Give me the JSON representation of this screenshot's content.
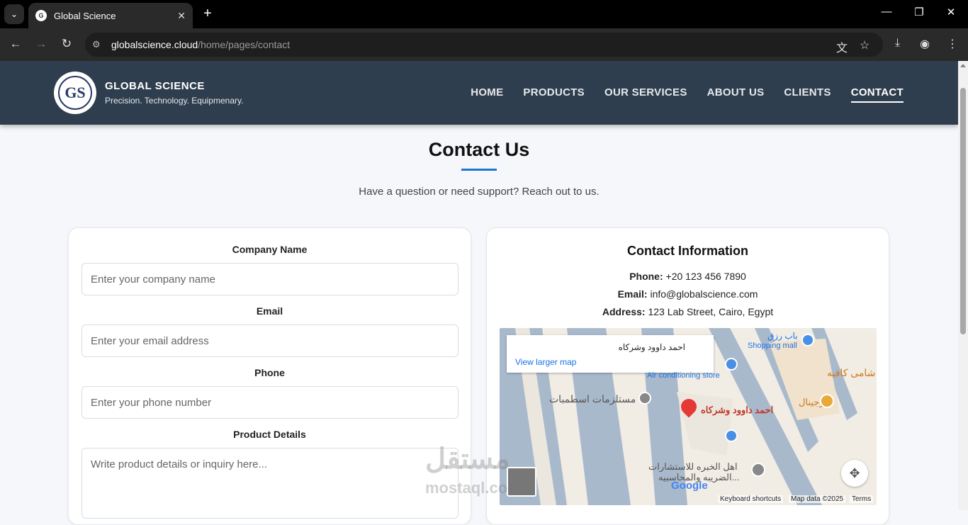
{
  "browser": {
    "tab_title": "Global Science",
    "url_domain": "globalscience.cloud",
    "url_path": "/home/pages/contact"
  },
  "header": {
    "brand_name": "GLOBAL SCIENCE",
    "tagline": "Precision. Technology. Equipmenary.",
    "logo_text": "GS",
    "nav": [
      "HOME",
      "PRODUCTS",
      "OUR SERVICES",
      "ABOUT US",
      "CLIENTS",
      "CONTACT"
    ],
    "active_nav": "CONTACT"
  },
  "page": {
    "title": "Contact Us",
    "subtitle": "Have a question or need support? Reach out to us."
  },
  "form": {
    "company_label": "Company Name",
    "company_placeholder": "Enter your company name",
    "email_label": "Email",
    "email_placeholder": "Enter your email address",
    "phone_label": "Phone",
    "phone_placeholder": "Enter your phone number",
    "details_label": "Product Details",
    "details_placeholder": "Write product details or inquiry here..."
  },
  "contact": {
    "title": "Contact Information",
    "phone_label": "Phone:",
    "phone": "+20 123 456 7890",
    "email_label": "Email:",
    "email": "info@globalscience.com",
    "address_label": "Address:",
    "address": "123 Lab Street, Cairo, Egypt"
  },
  "map": {
    "place_name": "احمد داوود وشركاه",
    "view_larger": "View larger map",
    "labels": {
      "mall": "باب رزق",
      "mall_sub": "Shopping mall",
      "ac_store": "Air conditioning store",
      "cafe": "شامى كافيه",
      "supplies": "مستلزمات اسطمبات",
      "pin_label": "احمد داوود وشركاه",
      "original": "اورجينال",
      "consult1": "اهل الخبره للاستشارات",
      "consult2": "الضريبه والمحاسبيه...",
      "google": "Google",
      "shortcuts": "Keyboard shortcuts",
      "mapdata": "Map data ©2025",
      "terms": "Terms"
    }
  },
  "watermark": {
    "arabic": "مستقل",
    "latin": "mostaql.com"
  }
}
